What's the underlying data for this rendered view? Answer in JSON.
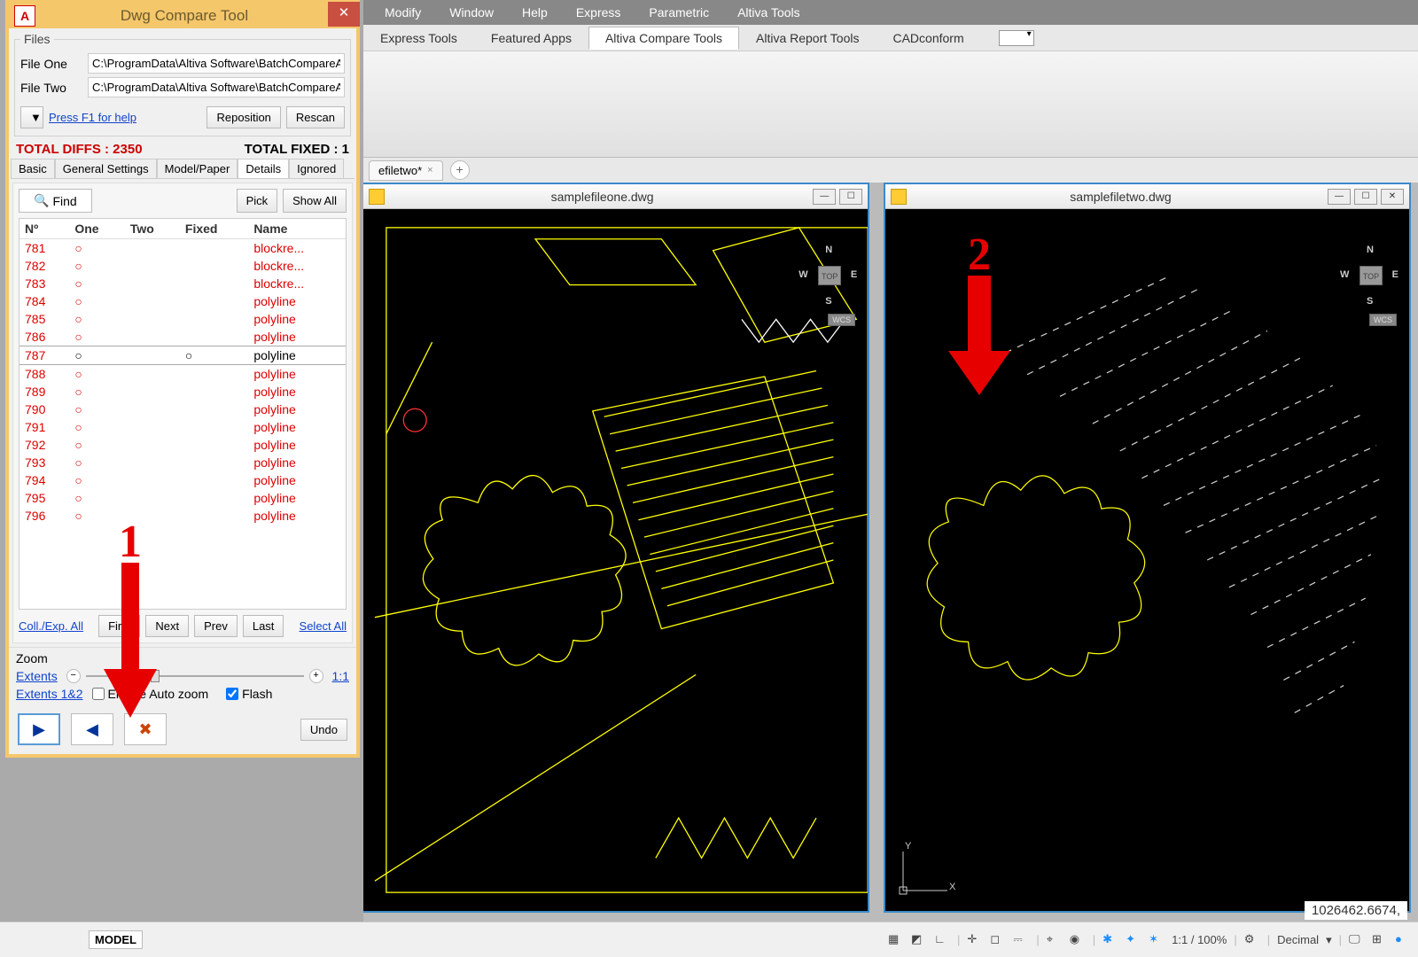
{
  "menubar": [
    "Modify",
    "Window",
    "Help",
    "Express",
    "Parametric",
    "Altiva Tools"
  ],
  "ribbon_tabs": [
    "Express Tools",
    "Featured Apps",
    "Altiva Compare Tools",
    "Altiva Report Tools",
    "CADconform"
  ],
  "ribbon_active": "Altiva Compare Tools",
  "doc_tab": {
    "label": "efiletwo*",
    "close": "×"
  },
  "viewport1": {
    "title": "samplefileone.dwg",
    "top": "TOP",
    "wcs": "WCS"
  },
  "viewport2": {
    "title": "samplefiletwo.dwg",
    "top": "TOP",
    "wcs": "WCS"
  },
  "navcube": {
    "n": "N",
    "s": "S",
    "e": "E",
    "w": "W"
  },
  "ucs": {
    "x": "X",
    "y": "Y"
  },
  "status": {
    "model": "MODEL",
    "scale": "1:1 / 100%",
    "units": "Decimal",
    "coords": "1026462.6674,"
  },
  "compare": {
    "title": "Dwg Compare Tool",
    "files_legend": "Files",
    "file_one_label": "File One",
    "file_two_label": "File Two",
    "file_one_value": "C:\\ProgramData\\Altiva Software\\BatchCompareA",
    "file_two_value": "C:\\ProgramData\\Altiva Software\\BatchCompareA",
    "help_link": "Press F1 for help",
    "reposition": "Reposition",
    "rescan": "Rescan",
    "total_diffs_label": "TOTAL DIFFS :",
    "total_diffs_value": "2350",
    "total_fixed_label": "TOTAL FIXED :",
    "total_fixed_value": "1",
    "tabs": [
      "Basic",
      "General Settings",
      "Model/Paper",
      "Details",
      "Ignored"
    ],
    "tab_active": "Details",
    "find": "Find",
    "pick": "Pick",
    "show_all": "Show All",
    "cols": [
      "Nº",
      "One",
      "Two",
      "Fixed",
      "Name"
    ],
    "rows": [
      {
        "n": "781",
        "one": "○",
        "two": "",
        "fixed": "",
        "name": "blockre..."
      },
      {
        "n": "782",
        "one": "○",
        "two": "",
        "fixed": "",
        "name": "blockre..."
      },
      {
        "n": "783",
        "one": "○",
        "two": "",
        "fixed": "",
        "name": "blockre..."
      },
      {
        "n": "784",
        "one": "○",
        "two": "",
        "fixed": "",
        "name": "polyline"
      },
      {
        "n": "785",
        "one": "○",
        "two": "",
        "fixed": "",
        "name": "polyline"
      },
      {
        "n": "786",
        "one": "○",
        "two": "",
        "fixed": "",
        "name": "polyline"
      },
      {
        "n": "787",
        "one": "○",
        "two": "",
        "fixed": "○",
        "name": "polyline",
        "selected": true
      },
      {
        "n": "788",
        "one": "○",
        "two": "",
        "fixed": "",
        "name": "polyline"
      },
      {
        "n": "789",
        "one": "○",
        "two": "",
        "fixed": "",
        "name": "polyline"
      },
      {
        "n": "790",
        "one": "○",
        "two": "",
        "fixed": "",
        "name": "polyline"
      },
      {
        "n": "791",
        "one": "○",
        "two": "",
        "fixed": "",
        "name": "polyline"
      },
      {
        "n": "792",
        "one": "○",
        "two": "",
        "fixed": "",
        "name": "polyline"
      },
      {
        "n": "793",
        "one": "○",
        "two": "",
        "fixed": "",
        "name": "polyline"
      },
      {
        "n": "794",
        "one": "○",
        "two": "",
        "fixed": "",
        "name": "polyline"
      },
      {
        "n": "795",
        "one": "○",
        "two": "",
        "fixed": "",
        "name": "polyline"
      },
      {
        "n": "796",
        "one": "○",
        "two": "",
        "fixed": "",
        "name": "polyline"
      }
    ],
    "coll_exp": "Coll./Exp. All",
    "first": "First",
    "next": "Next",
    "prev": "Prev",
    "last": "Last",
    "select_all": "Select All",
    "zoom_label": "Zoom",
    "extents": "Extents",
    "one_one": "1:1",
    "extents12": "Extents 1&2",
    "enable_autozoom": "Enable Auto zoom",
    "flash": "Flash",
    "undo": "Undo"
  },
  "annotations": {
    "one": "1",
    "two": "2"
  }
}
